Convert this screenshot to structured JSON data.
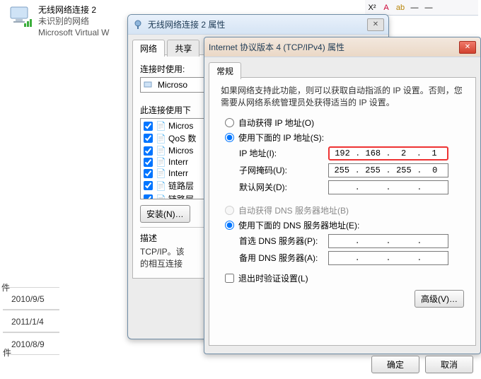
{
  "network_item": {
    "name": "无线网络连接 2",
    "status": "未识别的网络",
    "adapter": "Microsoft Virtual W"
  },
  "props_dialog": {
    "title": "无线网络连接 2 属性",
    "tab_network": "网络",
    "tab_share": "共享",
    "connect_using_label": "连接时使用:",
    "adapter_name": "Microso",
    "items_label": "此连接使用下",
    "items": [
      {
        "checked": true,
        "label": "Micros"
      },
      {
        "checked": true,
        "label": "QoS 数"
      },
      {
        "checked": true,
        "label": "Micros"
      },
      {
        "checked": true,
        "label": "Interr"
      },
      {
        "checked": true,
        "label": "Interr"
      },
      {
        "checked": true,
        "label": "链路层"
      },
      {
        "checked": true,
        "label": "链路层"
      }
    ],
    "install_btn": "安装(N)…",
    "desc_header": "描述",
    "desc_body": "TCP/IP。该\n的相互连接"
  },
  "ip_dialog": {
    "title": "Internet 协议版本 4 (TCP/IPv4) 属性",
    "tab_general": "常规",
    "intro": "如果网络支持此功能，则可以获取自动指派的 IP 设置。否则，您需要从网络系统管理员处获得适当的 IP 设置。",
    "radio_auto_ip": "自动获得 IP 地址(O)",
    "radio_manual_ip": "使用下面的 IP 地址(S):",
    "ip_label": "IP 地址(I):",
    "ip_value": [
      "192",
      "168",
      "2",
      "1"
    ],
    "mask_label": "子网掩码(U):",
    "mask_value": [
      "255",
      "255",
      "255",
      "0"
    ],
    "gateway_label": "默认网关(D):",
    "gateway_value": [
      "",
      "",
      "",
      ""
    ],
    "radio_auto_dns": "自动获得 DNS 服务器地址(B)",
    "radio_manual_dns": "使用下面的 DNS 服务器地址(E):",
    "dns1_label": "首选 DNS 服务器(P):",
    "dns2_label": "备用 DNS 服务器(A):",
    "exit_validate": "退出时验证设置(L)",
    "adv_btn": "高级(V)…",
    "ok_btn": "确定",
    "cancel_btn": "取消"
  },
  "left_dates": [
    "2010/9/5",
    "2011/1/4",
    "2010/8/9"
  ],
  "left_stub_top": "件",
  "left_stub_bottom": "件",
  "toolbar_fragment": {
    "items": [
      "X²",
      "A",
      "ab",
      "—",
      "—"
    ]
  }
}
